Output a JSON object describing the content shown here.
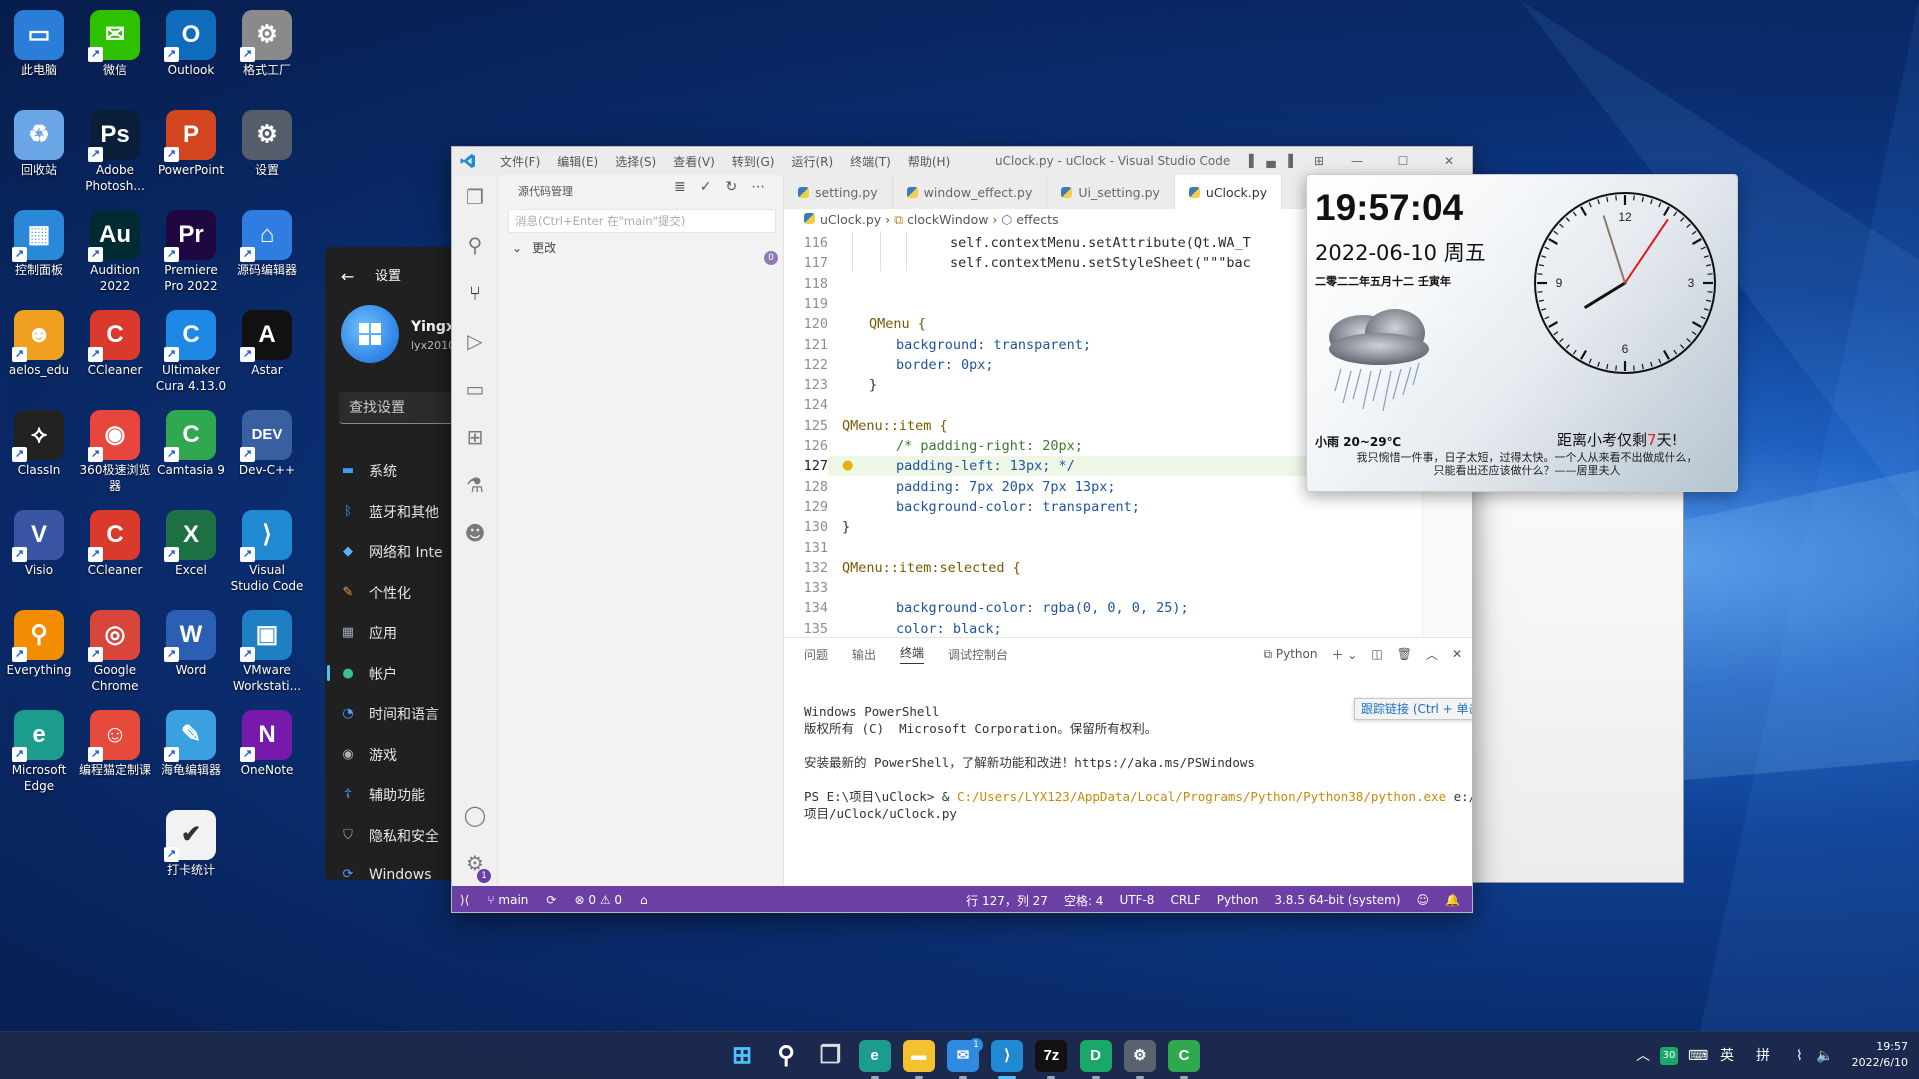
{
  "desktop": {
    "icons": [
      {
        "label": "此电脑",
        "icon": "computer-icon",
        "color": "#2a7ed8"
      },
      {
        "label": "微信",
        "icon": "wechat-icon",
        "color": "#2dc100"
      },
      {
        "label": "Outlook",
        "icon": "outlook-icon",
        "color": "#0f6cbd"
      },
      {
        "label": "格式工厂",
        "icon": "format-factory-icon",
        "color": "#8a8a8a"
      },
      {
        "label": "回收站",
        "icon": "recycle-bin-icon",
        "color": "#6aa6e6"
      },
      {
        "label": "Adobe Photosh...",
        "icon": "photoshop-icon",
        "color": "#0a1e3a"
      },
      {
        "label": "PowerPoint",
        "icon": "powerpoint-icon",
        "color": "#d2451e"
      },
      {
        "label": "设置",
        "icon": "settings-gear-icon",
        "color": "#555d6a"
      },
      {
        "label": "控制面板",
        "icon": "control-panel-icon",
        "color": "#2a88d8"
      },
      {
        "label": "Audition 2022",
        "icon": "audition-icon",
        "color": "#002b33"
      },
      {
        "label": "Premiere Pro 2022",
        "icon": "premiere-icon",
        "color": "#1f0740"
      },
      {
        "label": "源码编辑器",
        "icon": "code-editor-icon",
        "color": "#2f7de1"
      },
      {
        "label": "aelos_edu",
        "icon": "aelos-icon",
        "color": "#f0a020"
      },
      {
        "label": "CCleaner",
        "icon": "ccleaner-icon",
        "color": "#d93a2b"
      },
      {
        "label": "Ultimaker Cura 4.13.0",
        "icon": "cura-icon",
        "color": "#1e88e5"
      },
      {
        "label": "Astar",
        "icon": "astar-icon",
        "color": "#111111"
      },
      {
        "label": "ClassIn",
        "icon": "classin-icon",
        "color": "#222222"
      },
      {
        "label": "360极速浏览器",
        "icon": "360-browser-icon",
        "color": "#e8453c"
      },
      {
        "label": "Camtasia 9",
        "icon": "camtasia-icon",
        "color": "#2fa84f"
      },
      {
        "label": "Dev-C++",
        "icon": "devcpp-icon",
        "color": "#3a5fa0"
      },
      {
        "label": "Visio",
        "icon": "visio-icon",
        "color": "#3955a3"
      },
      {
        "label": "CCleaner",
        "icon": "ccleaner-icon",
        "color": "#d93a2b"
      },
      {
        "label": "Excel",
        "icon": "excel-icon",
        "color": "#1d7044"
      },
      {
        "label": "Visual Studio Code",
        "icon": "vscode-icon",
        "color": "#1f8ad2"
      },
      {
        "label": "Everything",
        "icon": "everything-icon",
        "color": "#f28c00"
      },
      {
        "label": "Google Chrome",
        "icon": "chrome-icon",
        "color": "#d8453a"
      },
      {
        "label": "Word",
        "icon": "word-icon",
        "color": "#2b5fb4"
      },
      {
        "label": "VMware Workstati...",
        "icon": "vmware-icon",
        "color": "#1e7fc2"
      },
      {
        "label": "Microsoft Edge",
        "icon": "edge-icon",
        "color": "#1c9c8c"
      },
      {
        "label": "编程猫定制课",
        "icon": "codemao-icon",
        "color": "#e64a3c"
      },
      {
        "label": "海龟编辑器",
        "icon": "turtle-editor-icon",
        "color": "#3aa0e0"
      },
      {
        "label": "OneNote",
        "icon": "onenote-icon",
        "color": "#7719aa"
      },
      {
        "label": "打卡统计",
        "icon": "checkin-stats-icon",
        "color": "#f2f2f2"
      }
    ]
  },
  "settings": {
    "title": "设置",
    "user_name": "Yingx",
    "user_email": "lyx2010",
    "search_placeholder": "查找设置",
    "nav": [
      {
        "label": "系统",
        "icon": "monitor-icon",
        "color": "#3aa0ff"
      },
      {
        "label": "蓝牙和其他",
        "icon": "bluetooth-icon",
        "color": "#3aa0ff"
      },
      {
        "label": "网络和 Inte",
        "icon": "network-icon",
        "color": "#5ab0ff"
      },
      {
        "label": "个性化",
        "icon": "brush-icon",
        "color": "#f0a050"
      },
      {
        "label": "应用",
        "icon": "apps-icon",
        "color": "#9aa4b8"
      },
      {
        "label": "帐户",
        "icon": "account-icon",
        "color": "#3ac08a"
      },
      {
        "label": "时间和语言",
        "icon": "globe-clock-icon",
        "color": "#4aa0ff"
      },
      {
        "label": "游戏",
        "icon": "gamepad-icon",
        "color": "#b0b0b0"
      },
      {
        "label": "辅助功能",
        "icon": "accessibility-icon",
        "color": "#4aa0ff"
      },
      {
        "label": "隐私和安全",
        "icon": "shield-icon",
        "color": "#9aa4b8"
      },
      {
        "label": "Windows",
        "icon": "windows-update-icon",
        "color": "#4aa0ff"
      }
    ],
    "active_index": 5
  },
  "vscode": {
    "menu": [
      "文件(F)",
      "编辑(E)",
      "选择(S)",
      "查看(V)",
      "转到(G)",
      "运行(R)",
      "终端(T)",
      "帮助(H)"
    ],
    "title": "uClock.py - uClock - Visual Studio Code",
    "sidebar": {
      "title": "源代码管理",
      "commit_placeholder": "消息(Ctrl+Enter 在\"main\"提交)",
      "changes_label": "更改",
      "changes_count": "0"
    },
    "tabs": [
      "setting.py",
      "window_effect.py",
      "Ui_setting.py",
      "uClock.py"
    ],
    "active_tab": 3,
    "breadcrumbs": [
      "uClock.py",
      "clockWindow",
      "effects"
    ],
    "lines": [
      {
        "n": "116",
        "text": "self.contextMenu.setAttribute(Qt.WA_T",
        "indent": 4
      },
      {
        "n": "117",
        "text": "self.contextMenu.setStyleSheet(\"\"\"bac",
        "indent": 4
      },
      {
        "n": "118",
        "text": "",
        "indent": 0
      },
      {
        "n": "119",
        "text": "",
        "indent": 0
      },
      {
        "n": "120",
        "text": "QMenu {",
        "indent": 1
      },
      {
        "n": "121",
        "text": "background: transparent;",
        "indent": 2
      },
      {
        "n": "122",
        "text": "border: 0px;",
        "indent": 2
      },
      {
        "n": "123",
        "text": "}",
        "indent": 1
      },
      {
        "n": "124",
        "text": "",
        "indent": 0
      },
      {
        "n": "125",
        "text": "QMenu::item {",
        "indent": 0
      },
      {
        "n": "126",
        "text": "/* padding-right: 20px;",
        "indent": 2
      },
      {
        "n": "127",
        "text": "padding-left: 13px; */",
        "indent": 2
      },
      {
        "n": "128",
        "text": "padding: 7px 20px 7px 13px;",
        "indent": 2
      },
      {
        "n": "129",
        "text": "background-color: transparent;",
        "indent": 2
      },
      {
        "n": "130",
        "text": "}",
        "indent": 0
      },
      {
        "n": "131",
        "text": "",
        "indent": 0
      },
      {
        "n": "132",
        "text": "QMenu::item:selected {",
        "indent": 0
      },
      {
        "n": "133",
        "text": "",
        "indent": 0
      },
      {
        "n": "134",
        "text": "background-color: rgba(0, 0, 0, 25);",
        "indent": 2
      },
      {
        "n": "135",
        "text": "color: black;",
        "indent": 2
      }
    ],
    "highlight_line": "127",
    "panel_tabs": [
      "问题",
      "输出",
      "终端",
      "调试控制台"
    ],
    "active_panel_tab": 2,
    "terminal_name": "Python",
    "terminal": {
      "line1": "Windows PowerShell",
      "line2": "版权所有 (C)  Microsoft Corporation。保留所有权利。",
      "line3": "安装最新的 PowerShell，了解新功能和改进！",
      "link": "https://aka.ms/PSWindows",
      "prompt": "PS E:\\项目\\uClock> & ",
      "path": "C:/Users/LYX123/AppData/Local/Programs/Python/Python38/python.exe",
      "arg1": " e:/",
      "arg2": "项目/uClock/uClock.py",
      "tooltip": "跟踪链接 (Ctrl + 单击)"
    },
    "status": {
      "branch": "main",
      "errors": "0",
      "warnings": "0",
      "position": "行 127，列 27",
      "spaces": "空格: 4",
      "encoding": "UTF-8",
      "eol": "CRLF",
      "language": "Python",
      "interpreter": "3.8.5 64-bit (system)"
    },
    "accent": "#6c3fa5"
  },
  "clock": {
    "time": "19:57:04",
    "date": "2022-06-10 周五",
    "lunar": "二零二二年五月十二 壬寅年",
    "weather": "小雨 20~29℃",
    "countdown_prefix": "距离小考仅剩",
    "countdown_days": "7",
    "countdown_suffix": "天!",
    "quote_line1": "我只惋惜一件事，日子太短，过得太快。一个人从来看不出做成什么，",
    "quote_line2": "只能看出还应该做什么？——居里夫人",
    "dial_numbers": [
      "12",
      "3",
      "6",
      "9"
    ],
    "hands": {
      "hour": 7.95,
      "minute": 57.07,
      "second": 4
    }
  },
  "taskbar": {
    "apps": [
      {
        "name": "start-button",
        "color": "#4cc2ff"
      },
      {
        "name": "search-icon",
        "color": "#ffffff"
      },
      {
        "name": "task-view-icon",
        "color": "#dddddd"
      },
      {
        "name": "edge-icon",
        "color": "#1c9c8c"
      },
      {
        "name": "file-explorer-icon",
        "color": "#f2c230"
      },
      {
        "name": "mail-icon",
        "color": "#2f8ae0"
      },
      {
        "name": "vscode-icon",
        "color": "#1f8ad2"
      },
      {
        "name": "7zip-icon",
        "color": "#111111"
      },
      {
        "name": "green-app-icon",
        "color": "#19a86a"
      },
      {
        "name": "settings-gear-icon",
        "color": "#5a6270"
      },
      {
        "name": "camtasia-icon",
        "color": "#2fa84f"
      }
    ],
    "tray_badge": "30",
    "ime_lang": "英",
    "ime_mode": "拼",
    "time": "19:57",
    "date": "2022/6/10",
    "notify_badge": "1"
  }
}
